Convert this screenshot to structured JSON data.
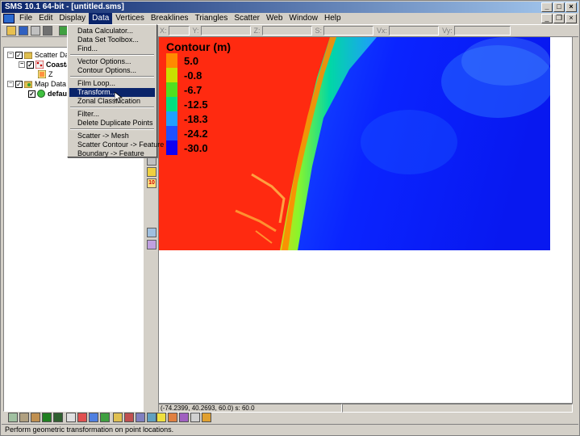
{
  "window": {
    "title": "SMS 10.1 64-bit - [untitled.sms]"
  },
  "menubar": {
    "items": [
      "File",
      "Edit",
      "Display",
      "Data",
      "Vertices",
      "Breaklines",
      "Triangles",
      "Scatter",
      "Web",
      "Window",
      "Help"
    ],
    "active": "Data"
  },
  "coords": {
    "x_label": "X:",
    "y_label": "Y:",
    "z_label": "Z:",
    "s_label": "S:",
    "vx_label": "Vx:",
    "vy_label": "Vy:"
  },
  "tree": {
    "scatter_data": "Scatter Data",
    "coastal": "Coastal",
    "z": "Z",
    "map_data": "Map Data",
    "default_coverage": "default"
  },
  "data_menu": {
    "items": [
      "Data Calculator...",
      "Data Set Toolbox...",
      "Find...",
      "Vector Options...",
      "Contour Options...",
      "Film Loop...",
      "Transform...",
      "Zonal Classification",
      "Filter...",
      "Delete Duplicate Points",
      "Scatter -> Mesh",
      "Scatter Contour -> Feature",
      "Boundary -> Feature"
    ],
    "highlighted": "Transform..."
  },
  "legend": {
    "title": "Contour (m)",
    "entries": [
      {
        "label": "5.0",
        "color": "#ff8a00"
      },
      {
        "label": "-0.8",
        "color": "#c8e000"
      },
      {
        "label": "-6.7",
        "color": "#50e020"
      },
      {
        "label": "-12.5",
        "color": "#00e080"
      },
      {
        "label": "-18.3",
        "color": "#20a0ff"
      },
      {
        "label": "-24.2",
        "color": "#2050ff"
      },
      {
        "label": "-30.0",
        "color": "#1000f0"
      }
    ]
  },
  "vtool_labels": {
    "ten": "10"
  },
  "status": {
    "coordinate_readout": "(-74.2399, 40.2693, 60.0) s: 60.0",
    "message": "Perform geometric transformation on point locations."
  },
  "colors": {
    "selection": "#0a246a",
    "face": "#d4d0c8",
    "land": "#ff2a10",
    "deep": "#0a1cff"
  }
}
